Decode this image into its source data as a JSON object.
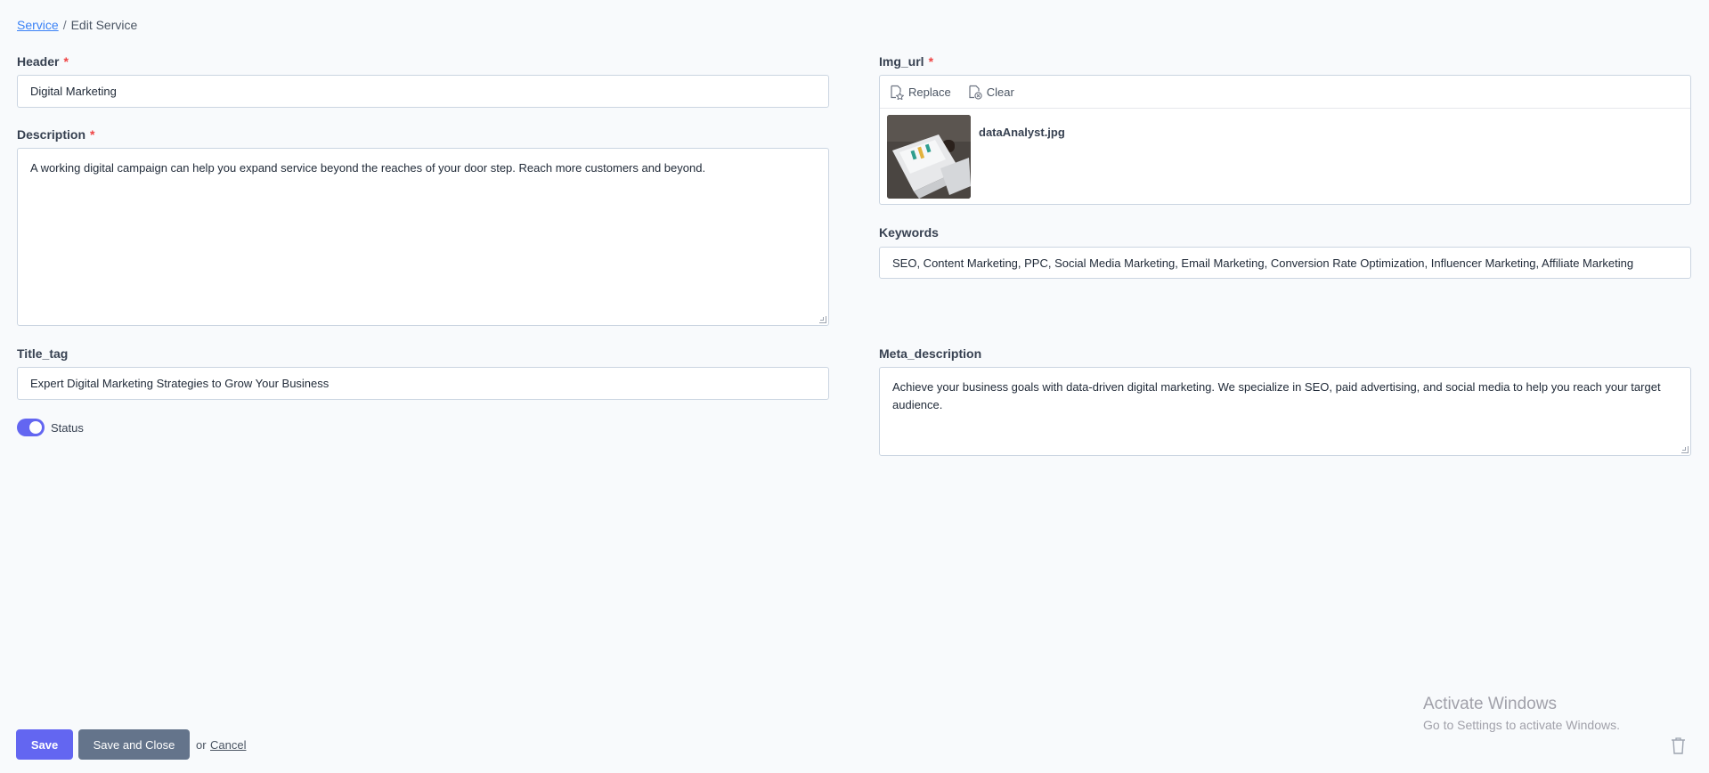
{
  "breadcrumb": {
    "root": "Service",
    "separator": "/",
    "current": "Edit Service"
  },
  "fields": {
    "header": {
      "label": "Header",
      "required_mark": "*",
      "value": "Digital Marketing"
    },
    "description": {
      "label": "Description",
      "required_mark": "*",
      "value": "A working digital campaign can help you expand service beyond the reaches of your door step. Reach more customers and beyond."
    },
    "title_tag": {
      "label": "Title_tag",
      "value": "Expert Digital Marketing Strategies to Grow Your Business"
    },
    "status": {
      "label": "Status",
      "enabled": true
    },
    "img_url": {
      "label": "Img_url",
      "required_mark": "*",
      "replace_label": "Replace",
      "clear_label": "Clear",
      "filename": "dataAnalyst.jpg"
    },
    "keywords": {
      "label": "Keywords",
      "value": "SEO, Content Marketing, PPC, Social Media Marketing, Email Marketing, Conversion Rate Optimization, Influencer Marketing, Affiliate Marketing"
    },
    "meta_description": {
      "label": "Meta_description",
      "value": "Achieve your business goals with data-driven digital marketing. We specialize in SEO, paid advertising, and social media to help you reach your target audience."
    }
  },
  "actions": {
    "save": "Save",
    "save_and_close": "Save and Close",
    "or": "or",
    "cancel": "Cancel"
  },
  "watermark": {
    "title": "Activate Windows",
    "subtitle": "Go to Settings to activate Windows."
  },
  "colors": {
    "accent": "#6366f1",
    "secondary_button": "#64748b",
    "required": "#ef4444",
    "link": "#3b82f6"
  }
}
